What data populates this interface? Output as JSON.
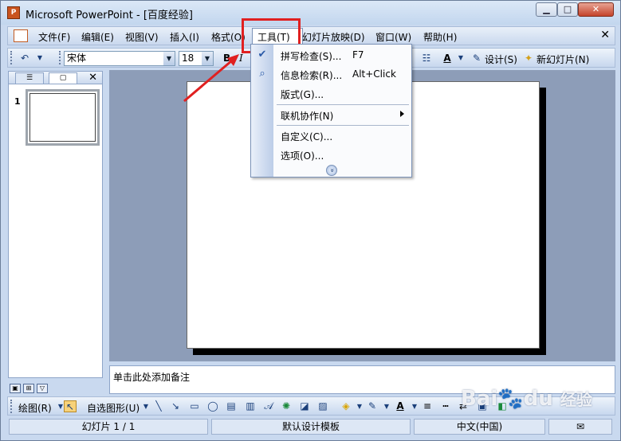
{
  "window": {
    "title": "Microsoft PowerPoint - [百度经验]",
    "app_icon_glyph": "P",
    "min_glyph": "▁",
    "max_glyph": "□",
    "close_glyph": "✕"
  },
  "menubar": {
    "items": [
      "文件(F)",
      "编辑(E)",
      "视图(V)",
      "插入(I)",
      "格式(O)",
      "工具(T)",
      "幻灯片放映(D)",
      "窗口(W)",
      "帮助(H)"
    ],
    "close_glyph": "✕"
  },
  "toolbar": {
    "font_name": "宋体",
    "font_size": "18",
    "bold": "B",
    "italic": "I",
    "design_label": "设计(S)",
    "new_slide_label": "新幻灯片(N)"
  },
  "tools_menu": {
    "items": [
      {
        "label": "拼写检查(S)...",
        "shortcut": "F7",
        "icon": "check-icon"
      },
      {
        "label": "信息检索(R)...",
        "shortcut": "Alt+Click",
        "icon": "research-icon"
      },
      {
        "label": "版式(G)...",
        "shortcut": "",
        "icon": ""
      },
      {
        "label": "联机协作(N)",
        "shortcut": "",
        "icon": "",
        "submenu": true
      },
      {
        "label": "自定义(C)...",
        "shortcut": "",
        "icon": ""
      },
      {
        "label": "选项(O)...",
        "shortcut": "",
        "icon": ""
      }
    ],
    "expand_glyph": "»"
  },
  "left_pane": {
    "close_glyph": "✕",
    "slide_number": "1"
  },
  "notes": {
    "placeholder": "单击此处添加备注"
  },
  "drawing_toolbar": {
    "draw_label": "绘图(R)",
    "autoshapes_label": "自选图形(U)"
  },
  "statusbar": {
    "slide_info": "幻灯片 1 / 1",
    "template": "默认设计模板",
    "language": "中文(中国)"
  },
  "watermark": {
    "brand": "Bai",
    "brand2": "du",
    "suffix": "经验"
  },
  "colors": {
    "highlight": "#e02020",
    "slide_bg": "#8d9db8"
  }
}
